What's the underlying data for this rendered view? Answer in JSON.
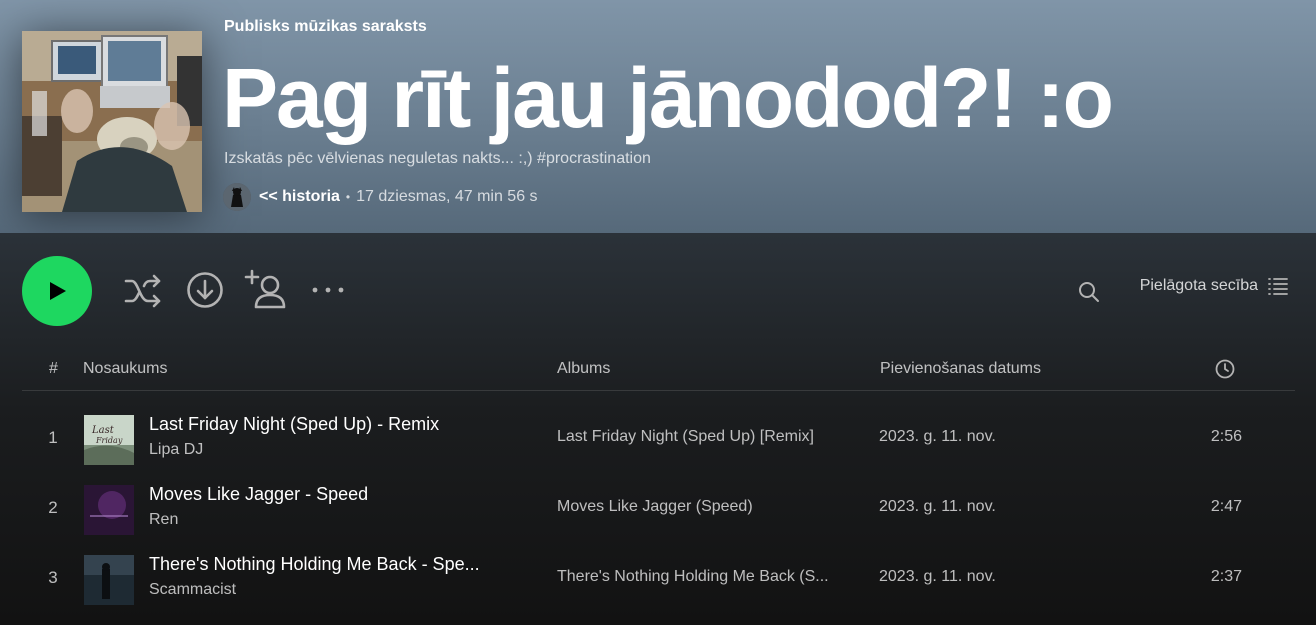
{
  "playlist": {
    "type_label": "Publisks mūzikas saraksts",
    "title": "Pag rīt jau jānodod?! :o",
    "description": "Izskatās pēc vēlvienas neguletas nakts... :,) #procrastination",
    "owner": "<< historia",
    "stats": "17 dziesmas, 47 min 56 s",
    "meta_separator": "•"
  },
  "actions": {
    "play_icon": "play-icon",
    "shuffle_icon": "shuffle-icon",
    "download_icon": "download-icon",
    "add_user_icon": "add-user-icon",
    "more_icon": "more-options-icon",
    "search_icon": "search-icon",
    "sort_label": "Pielāgota secība",
    "sort_icon": "list-icon"
  },
  "table": {
    "headers": {
      "number": "#",
      "title": "Nosaukums",
      "album": "Albums",
      "date_added": "Pievienošanas datums",
      "duration_icon": "clock-icon"
    },
    "rows": [
      {
        "number": "1",
        "title": "Last Friday Night (Sped Up) - Remix",
        "artist": "Lipa DJ",
        "album": "Last Friday Night (Sped Up) [Remix]",
        "date_added": "2023. g. 11. nov.",
        "duration": "2:56"
      },
      {
        "number": "2",
        "title": "Moves Like Jagger - Speed",
        "artist": "Ren",
        "album": "Moves Like Jagger (Speed)",
        "date_added": "2023. g. 11. nov.",
        "duration": "2:47"
      },
      {
        "number": "3",
        "title": "There's Nothing Holding Me Back - Spe...",
        "artist": "Scammacist",
        "album": "There's Nothing Holding Me Back (S...",
        "date_added": "2023. g. 11. nov.",
        "duration": "2:37"
      }
    ]
  },
  "colors": {
    "accent_green": "#1ed760",
    "header_top": "#8095a8",
    "background": "#121212"
  }
}
